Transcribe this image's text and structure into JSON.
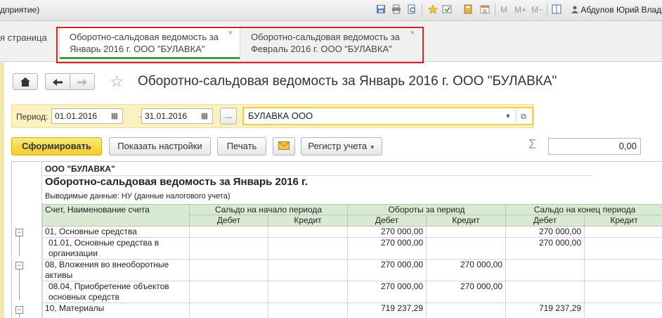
{
  "topbar": {
    "title": "дприятие)",
    "m_label": "M",
    "mplus_label": "M+",
    "mminus_label": "M−",
    "user": "Абдулов Юрий Владим"
  },
  "tabs": {
    "home": "я страница",
    "items": [
      {
        "label_line1": "Оборотно-сальдовая ведомость за",
        "label_line2": "Январь 2016 г. ООО \"БУЛАВКА\"",
        "close": "×"
      },
      {
        "label_line1": "Оборотно-сальдовая ведомость за",
        "label_line2": "Февраль 2016 г. ООО \"БУЛАВКА\"",
        "close": "×"
      }
    ]
  },
  "form": {
    "title": "Оборотно-сальдовая ведомость за Январь 2016 г. ООО \"БУЛАВКА\""
  },
  "params": {
    "period_label": "Период:",
    "date_from": "01.01.2016",
    "dash": "–",
    "date_to": "31.01.2016",
    "dots": "...",
    "organization": "БУЛАВКА ООО"
  },
  "toolbar": {
    "generate": "Сформировать",
    "show_settings": "Показать настройки",
    "print": "Печать",
    "register": "Регистр учета",
    "sigma": "Σ",
    "sum": "0,00"
  },
  "report": {
    "org": "ООО \"БУЛАВКА\"",
    "title": "Оборотно-сальдовая ведомость за Январь 2016 г.",
    "subtitle": "Выводимые данные:  НУ (данные налогового учета)",
    "headers": {
      "account": "Счет, Наименование счета",
      "opening": "Сальдо на начало периода",
      "turnover": "Обороты за период",
      "closing": "Сальдо на конец периода",
      "debit": "Дебет",
      "credit": "Кредит"
    },
    "rows": [
      {
        "name": "01, Основные средства",
        "od": "",
        "oc": "",
        "td": "270 000,00",
        "tc": "",
        "cd": "270 000,00",
        "cc": ""
      },
      {
        "name": "01.01, Основные средства в организации",
        "od": "",
        "oc": "",
        "td": "270 000,00",
        "tc": "",
        "cd": "270 000,00",
        "cc": ""
      },
      {
        "name": "08, Вложения во внеоборотные активы",
        "od": "",
        "oc": "",
        "td": "270 000,00",
        "tc": "270 000,00",
        "cd": "",
        "cc": ""
      },
      {
        "name": "08.04, Приобретение объектов основных средств",
        "od": "",
        "oc": "",
        "td": "270 000,00",
        "tc": "270 000,00",
        "cd": "",
        "cc": ""
      },
      {
        "name": "10, Материалы",
        "od": "",
        "oc": "",
        "td": "719 237,29",
        "tc": "",
        "cd": "719 237,29",
        "cc": ""
      }
    ]
  }
}
